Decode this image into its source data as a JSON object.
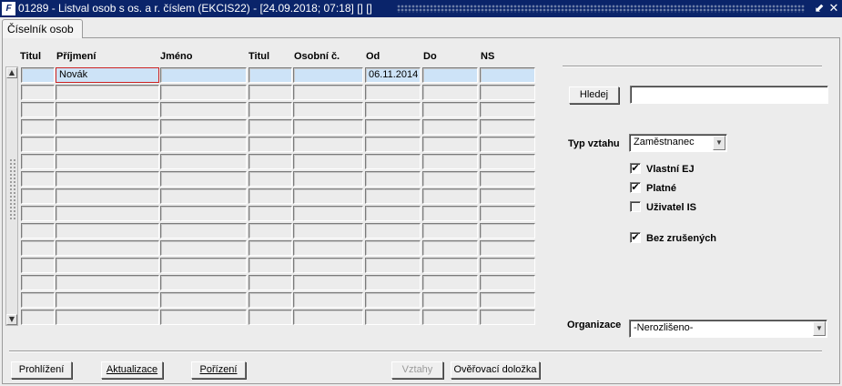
{
  "window": {
    "title": "01289 - Listval osob s os. a r. číslem (EKCIS22) - [24.09.2018; 07:18] [] []",
    "logo_text": "F",
    "minimize_glyph": "⬋",
    "close_glyph": "✕"
  },
  "tab": {
    "label": "Číselník osob"
  },
  "grid": {
    "columns": [
      "Titul",
      "Příjmení",
      "Jméno",
      "Titul",
      "Osobní č.",
      "Od",
      "Do",
      "NS"
    ],
    "rows": [
      [
        "",
        "Novák",
        "",
        "",
        "",
        "06.11.2014",
        "",
        ""
      ],
      [
        "",
        "",
        "",
        "",
        "",
        "",
        "",
        ""
      ],
      [
        "",
        "",
        "",
        "",
        "",
        "",
        "",
        ""
      ],
      [
        "",
        "",
        "",
        "",
        "",
        "",
        "",
        ""
      ],
      [
        "",
        "",
        "",
        "",
        "",
        "",
        "",
        ""
      ],
      [
        "",
        "",
        "",
        "",
        "",
        "",
        "",
        ""
      ],
      [
        "",
        "",
        "",
        "",
        "",
        "",
        "",
        ""
      ],
      [
        "",
        "",
        "",
        "",
        "",
        "",
        "",
        ""
      ],
      [
        "",
        "",
        "",
        "",
        "",
        "",
        "",
        ""
      ],
      [
        "",
        "",
        "",
        "",
        "",
        "",
        "",
        ""
      ],
      [
        "",
        "",
        "",
        "",
        "",
        "",
        "",
        ""
      ],
      [
        "",
        "",
        "",
        "",
        "",
        "",
        "",
        ""
      ],
      [
        "",
        "",
        "",
        "",
        "",
        "",
        "",
        ""
      ],
      [
        "",
        "",
        "",
        "",
        "",
        "",
        "",
        ""
      ],
      [
        "",
        "",
        "",
        "",
        "",
        "",
        "",
        ""
      ]
    ],
    "scroll_up_glyph": "▲",
    "scroll_down_glyph": "▼"
  },
  "search": {
    "button_label": "Hledej",
    "value": ""
  },
  "filters": {
    "typ_vztahu_label": "Typ vztahu",
    "typ_vztahu_value": "Zaměstnanec",
    "checkboxes": [
      {
        "label": "Vlastní EJ",
        "checked": true
      },
      {
        "label": "Platné",
        "checked": true
      },
      {
        "label": "Uživatel IS",
        "checked": false
      },
      {
        "label": "Bez zrušených",
        "checked": true
      }
    ],
    "check_glyph": "✔",
    "organizace_label": "Organizace",
    "organizace_value": "-Nerozlišeno-",
    "dropdown_glyph": "▼"
  },
  "buttons": {
    "prohlizeni": "Prohlížení",
    "aktualizace": "Aktualizace",
    "porizeni": "Pořízení",
    "vztahy": "Vztahy",
    "overovaci": "Ověřovací doložka"
  }
}
